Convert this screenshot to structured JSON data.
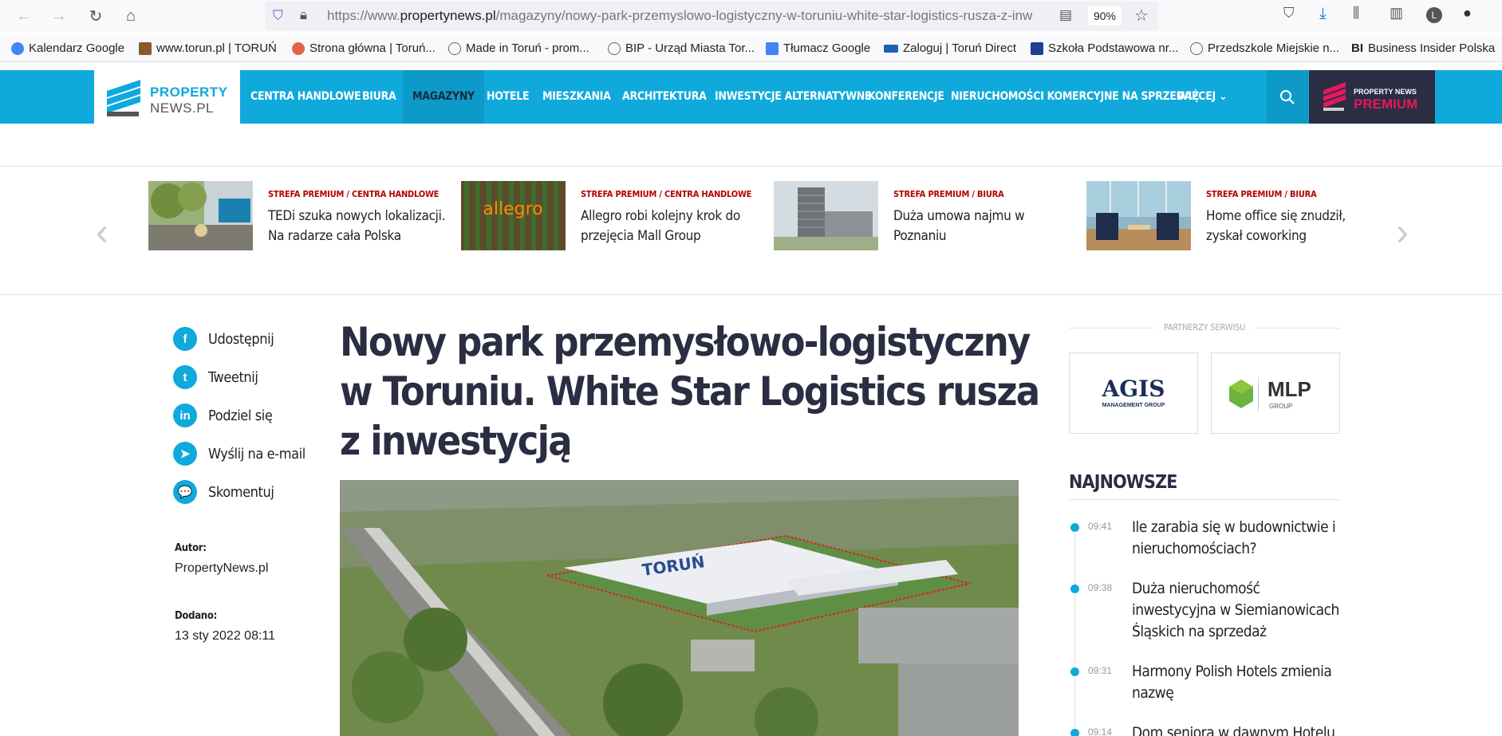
{
  "browser": {
    "url_prefix": "https://www.",
    "url_domain": "propertynews.pl",
    "url_path": "/magazyny/nowy-park-przemyslowo-logistyczny-w-toruniu-white-star-logistics-rusza-z-inw",
    "zoom": "90%",
    "profile_initial": "L"
  },
  "bookmarks": [
    {
      "label": "Kalendarz Google",
      "color": "#4285f4"
    },
    {
      "label": "www.torun.pl | TORUŃ",
      "color": "#8a5a2b"
    },
    {
      "label": "Strona główna | Toruń...",
      "color": "#e0664a"
    },
    {
      "label": "Made in Toruń - prom...",
      "color": "#666666"
    },
    {
      "label": "BIP - Urząd Miasta Tor...",
      "color": "#666666"
    },
    {
      "label": "Tłumacz Google",
      "color": "#4285f4"
    },
    {
      "label": "Zaloguj | Toruń Direct",
      "color": "#1f5fb3"
    },
    {
      "label": "Szkoła Podstawowa nr...",
      "color": "#1f3f8f"
    },
    {
      "label": "Przedszkole Miejskie n...",
      "color": "#666666"
    },
    {
      "label": "Business Insider Polska",
      "color": "#111111"
    }
  ],
  "site": {
    "logo_line1": "PROPERTY",
    "logo_line2": "NEWS.PL",
    "nav": [
      "CENTRA HANDLOWE",
      "BIURA",
      "MAGAZYNY",
      "HOTELE",
      "MIESZKANIA",
      "ARCHITEKTURA",
      "INWESTYCJE ALTERNATYWNE",
      "KONFERENCJE",
      "NIERUCHOMOŚCI KOMERCYJNE NA SPRZEDAŻ",
      "WIĘCEJ ⌄"
    ],
    "active_nav": "MAGAZYNY",
    "premium_line1": "PROPERTY NEWS",
    "premium_line2": "PREMIUM",
    "brand_color": "#0fa9dc",
    "premium_color": "#e2195b"
  },
  "carousel": [
    {
      "category": "STREFA PREMIUM / CENTRA HANDLOWE",
      "title": "TEDi szuka nowych lokalizacji. Na radarze cała Polska"
    },
    {
      "category": "STREFA PREMIUM / CENTRA HANDLOWE",
      "title": "Allegro robi kolejny krok do przejęcia Mall Group"
    },
    {
      "category": "STREFA PREMIUM / BIURA",
      "title": "Duża umowa najmu w Poznaniu"
    },
    {
      "category": "STREFA PREMIUM / BIURA",
      "title": "Home office się znudził, zyskał coworking"
    }
  ],
  "share": [
    {
      "label": "Udostępnij",
      "icon": "f"
    },
    {
      "label": "Tweetnij",
      "icon": "t"
    },
    {
      "label": "Podziel się",
      "icon": "in"
    },
    {
      "label": "Wyślij na e-mail",
      "icon": "➤"
    },
    {
      "label": "Skomentuj",
      "icon": "💬"
    }
  ],
  "meta": {
    "author_label": "Autor:",
    "author": "PropertyNews.pl",
    "added_label": "Dodano:",
    "added": "13 sty 2022 08:11"
  },
  "article": {
    "headline": "Nowy park przemysłowo-logistyczny w Toruniu. White Star Logistics rusza z inwestycją"
  },
  "sidebar": {
    "partners_label": "PARTNERZY SERWISU",
    "partner1_name": "AGIS",
    "partner1_sub": "MANAGEMENT GROUP",
    "partner2_name": "MLP",
    "partner2_sub": "GROUP",
    "newest_title": "NAJNOWSZE",
    "news": [
      {
        "time": "09:41",
        "title": "Ile zarabia się w budownictwie i nieruchomościach?"
      },
      {
        "time": "09:38",
        "title": "Duża nieruchomość inwestycyjna w Siemianowicach Śląskich na sprzedaż"
      },
      {
        "time": "09:31",
        "title": "Harmony Polish Hotels zmienia nazwę"
      },
      {
        "time": "09:14",
        "title": "Dom seniora w dawnym Hotelu"
      }
    ]
  }
}
